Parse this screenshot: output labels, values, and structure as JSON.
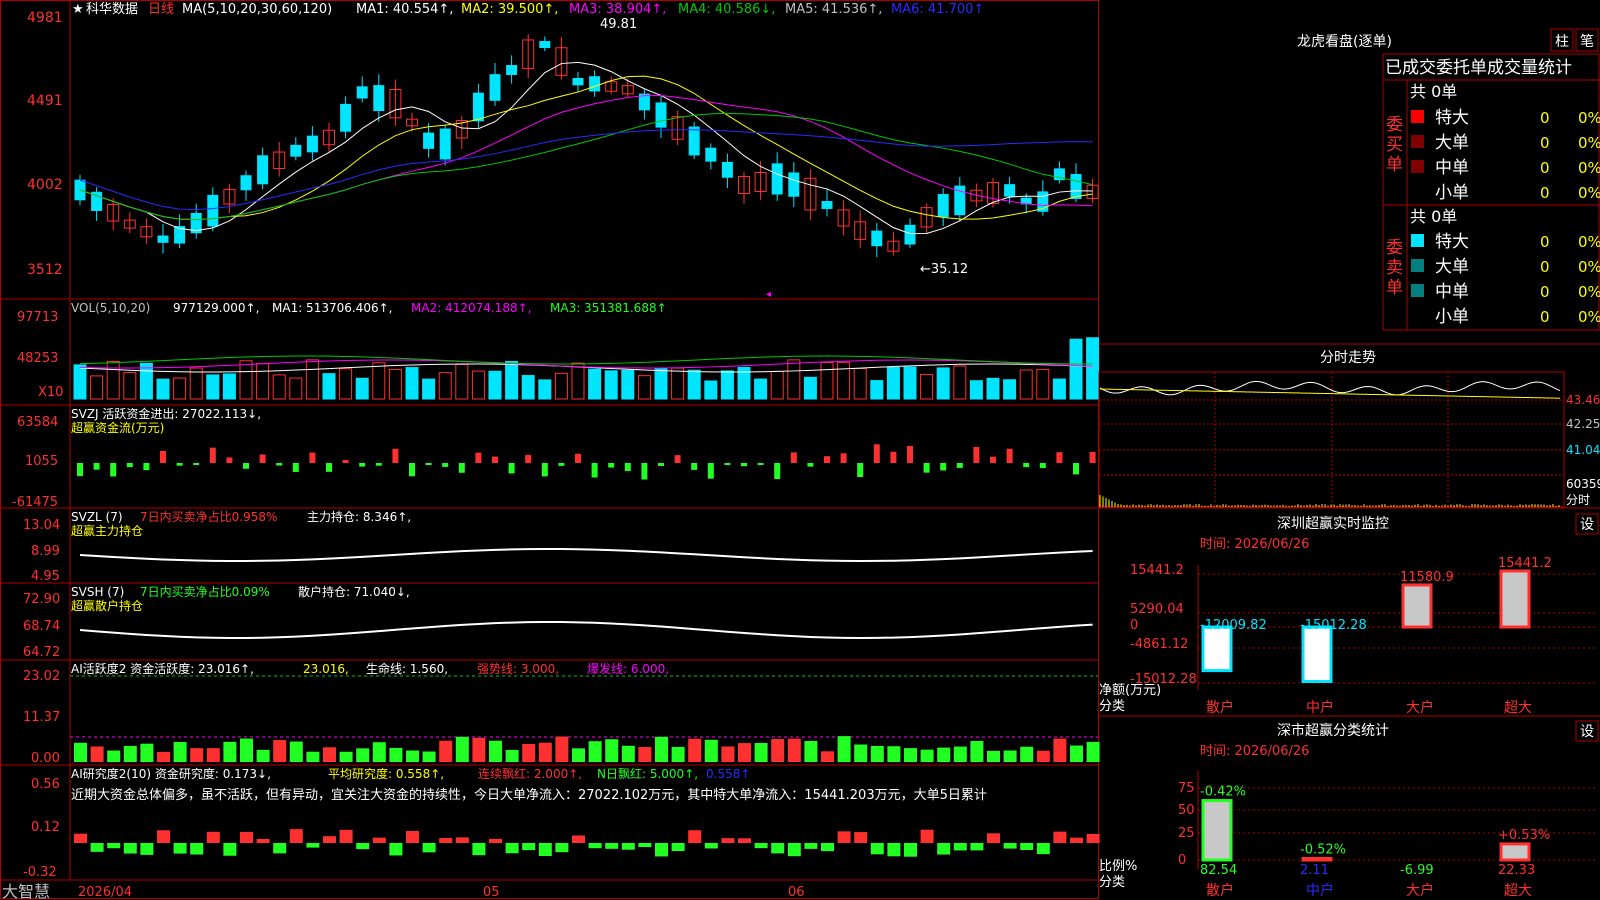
{
  "colors": {
    "red": "#ff3030",
    "cyan": "#00e5ff",
    "white": "#ffffff",
    "yellow": "#ffff00",
    "magenta": "#ff00ff",
    "green": "#00c800",
    "blue": "#2b2bff",
    "gray": "#c0c0c0",
    "frame": "#b00000",
    "lime": "#22ff22",
    "olive": "#808000"
  },
  "header": {
    "star": "★",
    "name": "科华数据",
    "period": "日线",
    "ma_label": "MA(5,10,20,30,60,120)",
    "ma1": "MA1: 40.554↑,",
    "ma2": "MA2: 39.500↑,",
    "ma3": "MA3: 38.904↑,",
    "ma4": "MA4: 40.586↓,",
    "ma5": "MA5: 41.536↑,",
    "ma6": "MA6: 41.700↑",
    "max_label": "49.81",
    "min_label": "←35.12"
  },
  "price_axis": [
    "4981",
    "4491",
    "4002",
    "3512"
  ],
  "vol_panel": {
    "title": "VOL(5,10,20)",
    "v": "977129.000↑,",
    "ma1": "MA1: 513706.406↑,",
    "ma2": "MA2: 412074.188↑,",
    "ma3": "MA3: 351381.688↑",
    "axis": [
      "97713",
      "48253"
    ],
    "unit": "X10"
  },
  "svzj_panel": {
    "title": "SVZJ  活跃资金进出: 27022.113↓,",
    "sub": "超赢资金流(万元)",
    "axis": [
      "63584",
      "1055",
      "-61475"
    ]
  },
  "svzl_panel": {
    "title": "SVZL (7)",
    "pct": "7日内买卖净占比0.958%",
    "hold": "主力持仓: 8.346↑,",
    "sub": "超赢主力持仓",
    "axis": [
      "13.04",
      "8.99",
      "4.95"
    ]
  },
  "svsh_panel": {
    "title": "SVSH (7)",
    "pct": "7日内买卖净占比0.09%",
    "hold": "散户持仓: 71.040↓,",
    "sub": "超赢散户持仓",
    "axis": [
      "72.90",
      "68.74",
      "64.72"
    ]
  },
  "ai1_panel": {
    "title": "AI活跃度2 资金活跃度: 23.016↑,",
    "v2": "23.016,",
    "life": "生命线: 1.560,",
    "strong": "强势线: 3.000,",
    "burst": "爆发线: 6.000,",
    "axis": [
      "23.02",
      "11.37",
      "0.00"
    ]
  },
  "ai2_panel": {
    "title": "AI研究度2(10) 资金研究度: 0.173↓,",
    "avg": "平均研究度: 0.558↑,",
    "cont": "连续飘红: 2.000↑,",
    "n": "N日飘红: 5.000↑,",
    "extra": "0.558↑",
    "text": "近期大资金总体偏多，虽不活跃，但有异动，宜关注大资金的持续性，今日大单净流入：27022.102万元，其中特大单净流入：15441.203万元，大单5日累计",
    "axis": [
      "0.56",
      "0.12",
      "-0.32"
    ]
  },
  "bottom": {
    "brand": "大智慧",
    "dates": [
      "2026/04",
      "05",
      "06"
    ]
  },
  "right": {
    "title": "龙虎看盘(逐单)",
    "btn1": "柱",
    "btn2": "笔",
    "section": "已成交委托单成交量统计",
    "buy_label": "委买单",
    "sell_label": "委卖单",
    "buy_total": "共 0单",
    "sell_total": "共 0单",
    "rows": [
      {
        "name": "特大",
        "v": "0",
        "p": "0%"
      },
      {
        "name": "大单",
        "v": "0",
        "p": "0%"
      },
      {
        "name": "中单",
        "v": "0",
        "p": "0%"
      },
      {
        "name": "小单",
        "v": "0",
        "p": "0%"
      }
    ],
    "fenshi_title": "分时走势",
    "fenshi_axis": [
      "43.46",
      "42.25",
      "41.04",
      "60359",
      "分时"
    ],
    "sz_title": "深圳超赢实时监控",
    "sz_btn": "设",
    "sz_time": "时间: 2026/06/26",
    "sz_axis": [
      "15441.2",
      "5290.04",
      "0",
      "-4861.12",
      "-15012.28"
    ],
    "sz_ylabel": "净额(万元)",
    "sz_xlabel": "分类",
    "sz_vals": [
      "-12009.82",
      "-15012.28",
      "11580.9",
      "15441.2"
    ],
    "cats": [
      "散户",
      "中户",
      "大户",
      "超大"
    ],
    "sc_title": "深市超赢分类统计",
    "sc_btn": "设",
    "sc_time": "时间: 2026/06/26",
    "sc_axis": [
      "75",
      "50",
      "25",
      "0"
    ],
    "sc_ylabel": "比例%",
    "sc_xlabel": "分类",
    "sc_top": [
      "-0.42%",
      "-0.52%",
      "",
      "+0.53%"
    ],
    "sc_vals": [
      "82.54",
      "2.11",
      "-6.99",
      "22.33"
    ]
  },
  "chart_data": [
    {
      "type": "candlestick",
      "title": "科华数据 日线",
      "ylim": [
        35.12,
        49.81
      ],
      "series": [
        {
          "name": "MA1",
          "values": [
            40.554
          ]
        },
        {
          "name": "MA2",
          "values": [
            39.5
          ]
        },
        {
          "name": "MA3",
          "values": [
            38.904
          ]
        },
        {
          "name": "MA4",
          "values": [
            40.586
          ]
        },
        {
          "name": "MA5",
          "values": [
            41.536
          ]
        },
        {
          "name": "MA6",
          "values": [
            41.7
          ]
        }
      ]
    },
    {
      "type": "bar",
      "title": "深圳超赢实时监控",
      "categories": [
        "散户",
        "中户",
        "大户",
        "超大"
      ],
      "values": [
        -12009.82,
        -15012.28,
        11580.9,
        15441.2
      ],
      "ylabel": "净额(万元)",
      "xlabel": "分类",
      "ylim": [
        -15012.28,
        15441.2
      ]
    },
    {
      "type": "bar",
      "title": "深市超赢分类统计",
      "categories": [
        "散户",
        "中户",
        "大户",
        "超大"
      ],
      "values": [
        82.54,
        2.11,
        -6.99,
        22.33
      ],
      "ylabel": "比例%",
      "xlabel": "分类",
      "ylim": [
        0,
        75
      ]
    }
  ]
}
